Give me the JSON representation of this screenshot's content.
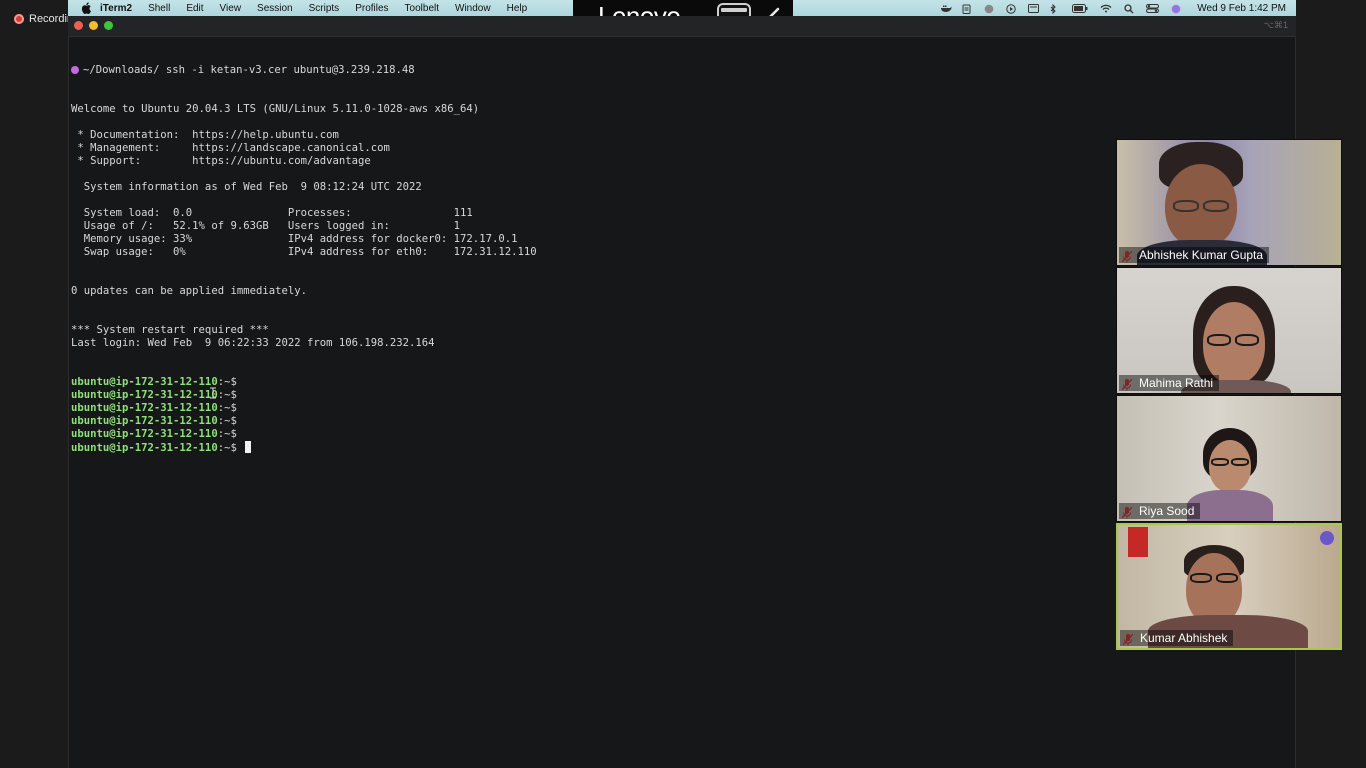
{
  "recording": {
    "label": "Recording"
  },
  "menubar": {
    "items": [
      "iTerm2",
      "Shell",
      "Edit",
      "View",
      "Session",
      "Scripts",
      "Profiles",
      "Toolbelt",
      "Window",
      "Help"
    ],
    "clock": "Wed 9 Feb  1:42 PM",
    "status_icons": [
      "docker-icon",
      "clipboard-icon",
      "globe-icon",
      "play-icon",
      "screen-icon",
      "bluetooth-icon",
      "battery-icon",
      "wifi-icon",
      "search-icon",
      "control-center-icon",
      "siri-icon"
    ]
  },
  "overlay": {
    "logo": "Lenovo"
  },
  "titlebar": {
    "shortcut": "⌥⌘1"
  },
  "terminal": {
    "command_line": "~/Downloads/ ssh -i ketan-v3.cer ubuntu@3.239.218.48",
    "lines": [
      "Welcome to Ubuntu 20.04.3 LTS (GNU/Linux 5.11.0-1028-aws x86_64)",
      "",
      " * Documentation:  https://help.ubuntu.com",
      " * Management:     https://landscape.canonical.com",
      " * Support:        https://ubuntu.com/advantage",
      "",
      "  System information as of Wed Feb  9 08:12:24 UTC 2022",
      "",
      "  System load:  0.0               Processes:                111",
      "  Usage of /:   52.1% of 9.63GB   Users logged in:          1",
      "  Memory usage: 33%               IPv4 address for docker0: 172.17.0.1",
      "  Swap usage:   0%                IPv4 address for eth0:    172.31.12.110",
      "",
      "",
      "0 updates can be applied immediately.",
      "",
      "",
      "*** System restart required ***",
      "Last login: Wed Feb  9 06:22:33 2022 from 106.198.232.164"
    ],
    "prompt_user": "ubuntu@ip-172-31-12-110",
    "prompt_suffix": ":~$",
    "prompt_count": 6
  },
  "participants": [
    {
      "name": "Abhishek Kumar Gupta",
      "muted": true,
      "active": false
    },
    {
      "name": "Mahima Rathi",
      "muted": true,
      "active": false
    },
    {
      "name": "Riya Sood",
      "muted": true,
      "active": false
    },
    {
      "name": "Kumar Abhishek",
      "muted": true,
      "active": true
    }
  ]
}
